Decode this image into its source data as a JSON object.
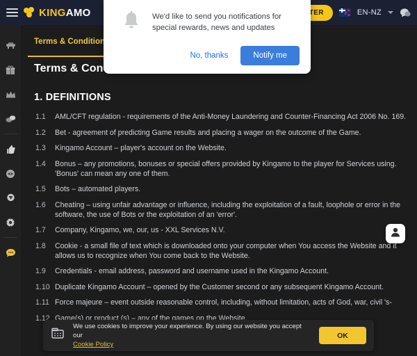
{
  "colors": {
    "brand_yellow": "#f5c518",
    "header_bg": "#1b2033",
    "page_bg": "#1c1c1c",
    "sidebar_bg": "#212121",
    "dialog_blue": "#3b7ddd",
    "link_blue": "#1a73e8"
  },
  "header": {
    "menu_icon": "hamburger-menu-icon",
    "logo": {
      "part1": "KING",
      "part2": "AMO",
      "icon": "clover-icon"
    },
    "register_label": "TER",
    "language": {
      "code": "EN-NZ",
      "flag": "new-zealand-flag-icon",
      "chevron": "chevron-down-icon"
    },
    "chat_icon": "chat-bubble-icon"
  },
  "sidebar": {
    "items": [
      {
        "name": "sidebar-item-casino",
        "icon": "casino-table-icon"
      },
      {
        "name": "sidebar-item-bonuses",
        "icon": "gift-icon"
      },
      {
        "name": "sidebar-item-vip",
        "icon": "crown-icon"
      },
      {
        "name": "sidebar-item-jackpots",
        "icon": "coins-icon"
      },
      {
        "name": "sidebar-item-favourites",
        "icon": "thumb-up-icon"
      },
      {
        "name": "sidebar-item-live",
        "icon": "coin-icon"
      },
      {
        "name": "sidebar-item-tournaments",
        "icon": "trophy-icon"
      },
      {
        "name": "sidebar-item-settings",
        "icon": "gear-icon"
      },
      {
        "name": "sidebar-item-support-chat",
        "icon": "chat-bubble-icon"
      }
    ]
  },
  "main": {
    "tabs": [
      {
        "label": "Terms & Conditions",
        "active": true
      }
    ],
    "page_title": "Terms & Conditions",
    "section_number_title": "1. DEFINITIONS",
    "clauses": [
      {
        "num": "1.1",
        "text": "AML/CFT regulation - requirements of the Anti-Money Laundering and Counter-Financing Act 2006 No. 169."
      },
      {
        "num": "1.2",
        "text": "Bet - agreement of predicting Game results and placing a wager on the outcome of the Game."
      },
      {
        "num": "1.3",
        "text": "Kingamo Account – player's account on the Website."
      },
      {
        "num": "1.4",
        "text": "Bonus – any promotions, bonuses or special offers provided by Kingamo to the player for Services using. 'Bonus' can mean any one of them."
      },
      {
        "num": "1.5",
        "text": "Bots – automated players."
      },
      {
        "num": "1.6",
        "text": "Cheating – using unfair advantage or influence, including the exploitation of a fault, loophole or error in the software, the use of Bots or the exploitation of an 'error'."
      },
      {
        "num": "1.7",
        "text": "Company, Kingamo, we, our, us - XXL Services N.V."
      },
      {
        "num": "1.8",
        "text": "Cookie - a small file of text which is downloaded onto your computer when You access the Website and it allows us to recognize when You come back to the Website."
      },
      {
        "num": "1.9",
        "text": "Credentials - email address, password and username used in the Kingamo Account."
      },
      {
        "num": "1.10",
        "text": "Duplicate Kingamo Account – opened by the Customer second or any subsequent Kingamo Account."
      },
      {
        "num": "1.11",
        "text": "Force majeure – event outside reasonable control, including, without limitation, acts of God, war, civil 's-"
      },
      {
        "num": "1.12",
        "text": "Game(s) or product (s) – any of the games on the Website."
      }
    ]
  },
  "support_fab": {
    "icon": "support-agent-icon"
  },
  "cookie_banner": {
    "icon": "cookie-icon",
    "text": "We use cookies to improve your experience. By using our website you accept our",
    "link_label": "Cookie Policy",
    "ok_label": "OK"
  },
  "notification_dialog": {
    "icon": "bell-icon",
    "message": "We'd like to send you notifications for special rewards, news and updates",
    "decline_label": "No, thanks",
    "accept_label": "Notify me"
  }
}
